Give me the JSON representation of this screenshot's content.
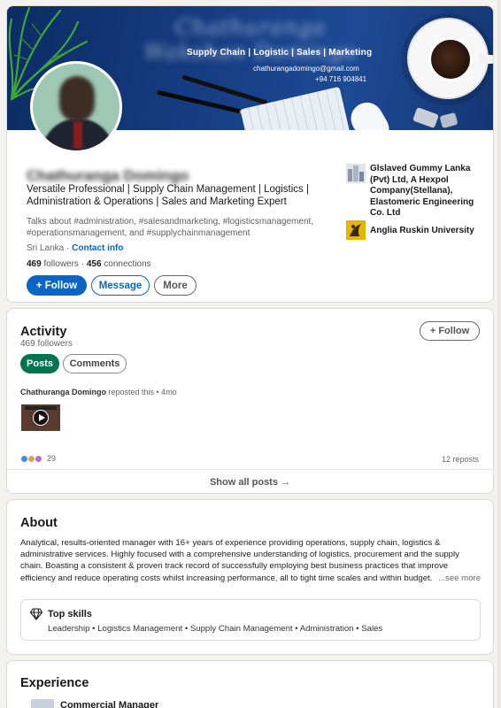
{
  "banner": {
    "blurred_name": "Chathuranga Wakshan Domingo",
    "tagline": "Supply Chain | Logistic | Sales | Marketing",
    "email": "chathurangadomingo@gmail.com",
    "phone": "+94 716 904841"
  },
  "profile": {
    "name": "Chathuranga Domingo",
    "headline": "Versatile Professional | Supply Chain Management | Logistics | Administration & Operations | Sales and Marketing Expert",
    "talks_about": "Talks about #administration, #salesandmarketing, #logisticsmanagement, #operationsmanagement, and #supplychainmanagement",
    "location": "Sri Lanka",
    "contact_label": "Contact info",
    "followers_count": "469",
    "followers_label": "followers",
    "connections_count": "456",
    "connections_label": "connections",
    "buttons": {
      "follow": "+ Follow",
      "message": "Message",
      "more": "More"
    },
    "orgs": [
      {
        "name": "Glslaved Gummy Lanka (Pvt) Ltd, A Hexpol Company(Stellana), Elastomeric Engineering Co. Ltd"
      },
      {
        "name": "Anglia Ruskin University"
      }
    ]
  },
  "activity": {
    "title": "Activity",
    "followers": "469 followers",
    "follow_button": "+ Follow",
    "tabs": {
      "posts": "Posts",
      "comments": "Comments"
    },
    "repost_author": "Chathuranga Domingo",
    "repost_meta": " reposted this • 4mo",
    "reactions_count": "29",
    "reposts": "12 reposts",
    "show_all": "Show all posts →"
  },
  "about": {
    "title": "About",
    "text": "Analytical, results-oriented manager with 16+ years of experience providing operations, supply chain, logistics & administrative services. Highly focused with a comprehensive understanding of logistics, procurement and the supply chain. Boasting a consistent & proven track record of successfully employing best business practices that improve efficiency and reduce operating costs whilst increasing performance, all to tight time scales and within budget.",
    "see_more": "...see more",
    "top_skills_title": "Top skills",
    "top_skills": "Leadership • Logistics Management • Supply Chain Management • Administration • Sales"
  },
  "experience": {
    "title": "Experience",
    "first_role": "Commercial Manager"
  },
  "colors": {
    "brand_blue": "#0a66c2",
    "posts_green": "#01754f",
    "banner_blue": "#173f86"
  }
}
